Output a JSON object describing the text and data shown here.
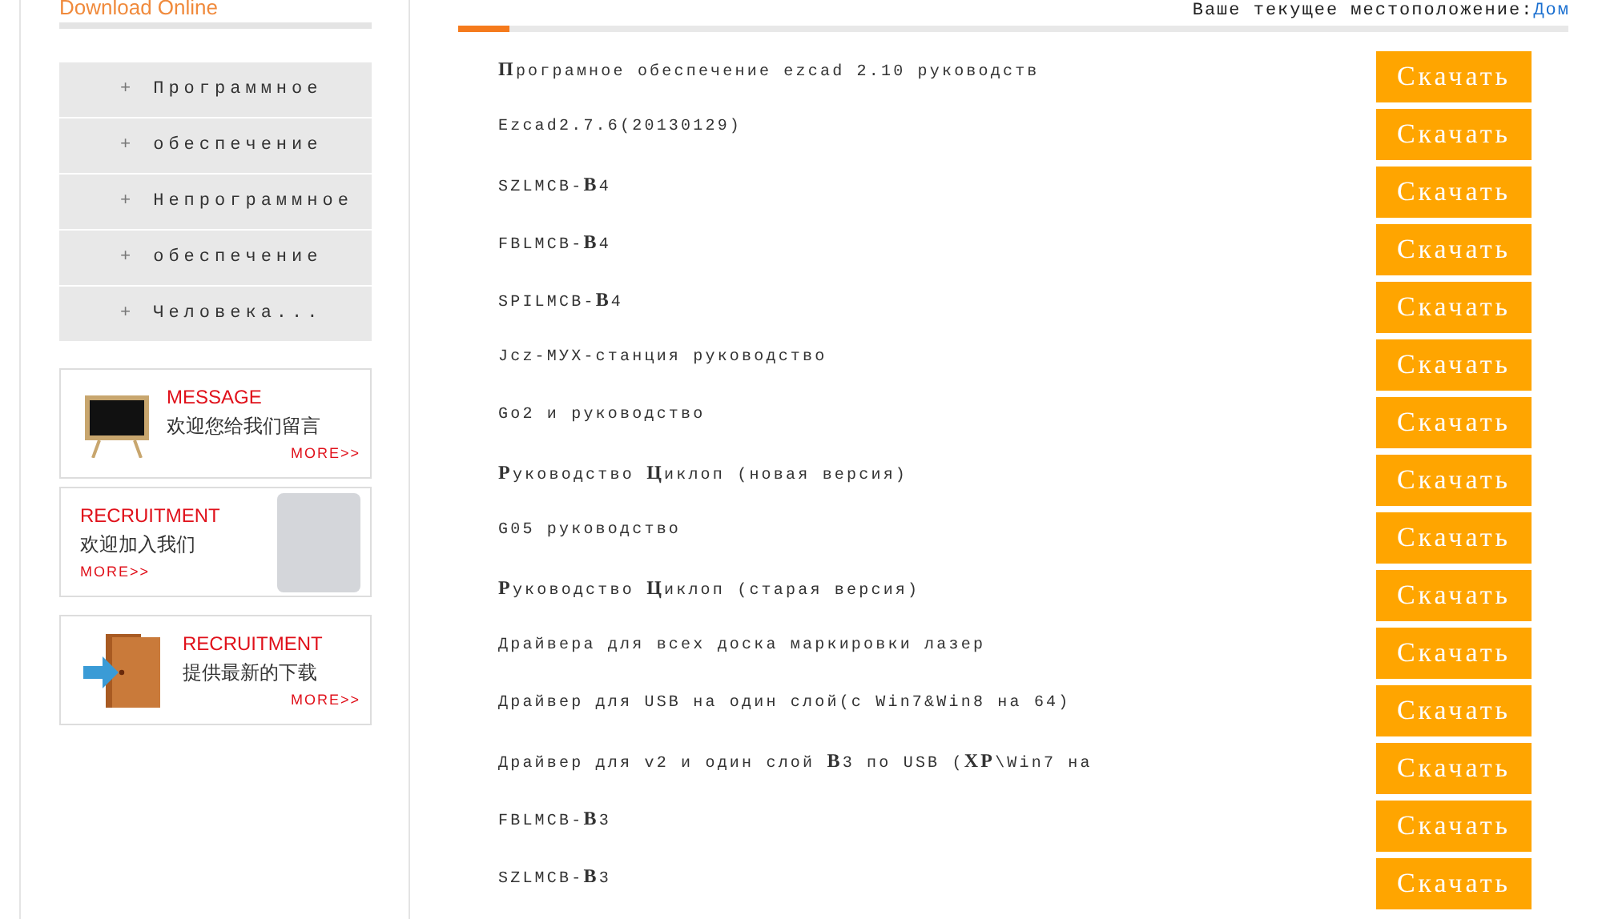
{
  "sidebar": {
    "heading": "Download Online",
    "items": [
      {
        "icon": "+",
        "label": "Программное"
      },
      {
        "icon": "+",
        "label": "обеспечение"
      },
      {
        "icon": "+",
        "label": "Непрограммное"
      },
      {
        "icon": "+",
        "label": "обеспечение"
      },
      {
        "icon": "+",
        "label": "Человека..."
      }
    ],
    "promos": [
      {
        "kind": "board",
        "title": "MESSAGE",
        "text": "欢迎您给我们留言",
        "more": "MORE>>"
      },
      {
        "kind": "person",
        "title": "RECRUITMENT",
        "text": "欢迎加入我们",
        "more": "MORE>>"
      },
      {
        "kind": "door",
        "title": "RECRUITMENT",
        "text": "提供最新的下载",
        "more": "MORE>>"
      }
    ]
  },
  "breadcrumb": {
    "label": "Ваше текущее местоположение:",
    "link": "Дом"
  },
  "downloads": [
    {
      "title": "**П**рограмное обеспечение ezcad 2.10 руководств",
      "button": "Скачать"
    },
    {
      "title": "Ezcad2.7.6(20130129)",
      "button": "Скачать"
    },
    {
      "title": "SZLMCB-**B**4",
      "button": "Скачать"
    },
    {
      "title": "FBLMCB-**B**4",
      "button": "Скачать"
    },
    {
      "title": "SPILMCB-**B**4",
      "button": "Скачать"
    },
    {
      "title": "Jcz-МУХ-станция руководство",
      "button": "Скачать"
    },
    {
      "title": "Go2 и руководство",
      "button": "Скачать"
    },
    {
      "title": "**Р**уководство **Ц**иклоп (новая версия)",
      "button": "Скачать"
    },
    {
      "title": "G05 руководство",
      "button": "Скачать"
    },
    {
      "title": "**Р**уководство **Ц**иклоп (старая версия)",
      "button": "Скачать"
    },
    {
      "title": "Драйвера для всех доска маркировки лазер",
      "button": "Скачать"
    },
    {
      "title": "Драйвер для USB на один слой(с Win7&Win8 на 64)",
      "button": "Скачать"
    },
    {
      "title": "Драйвер для v2 и один слой **B**3 по USB (**XP**\\Win7 на",
      "button": "Скачать"
    },
    {
      "title": "FBLMCB-**B**3",
      "button": "Скачать"
    },
    {
      "title": "SZLMCB-**B**3",
      "button": "Скачать"
    }
  ]
}
